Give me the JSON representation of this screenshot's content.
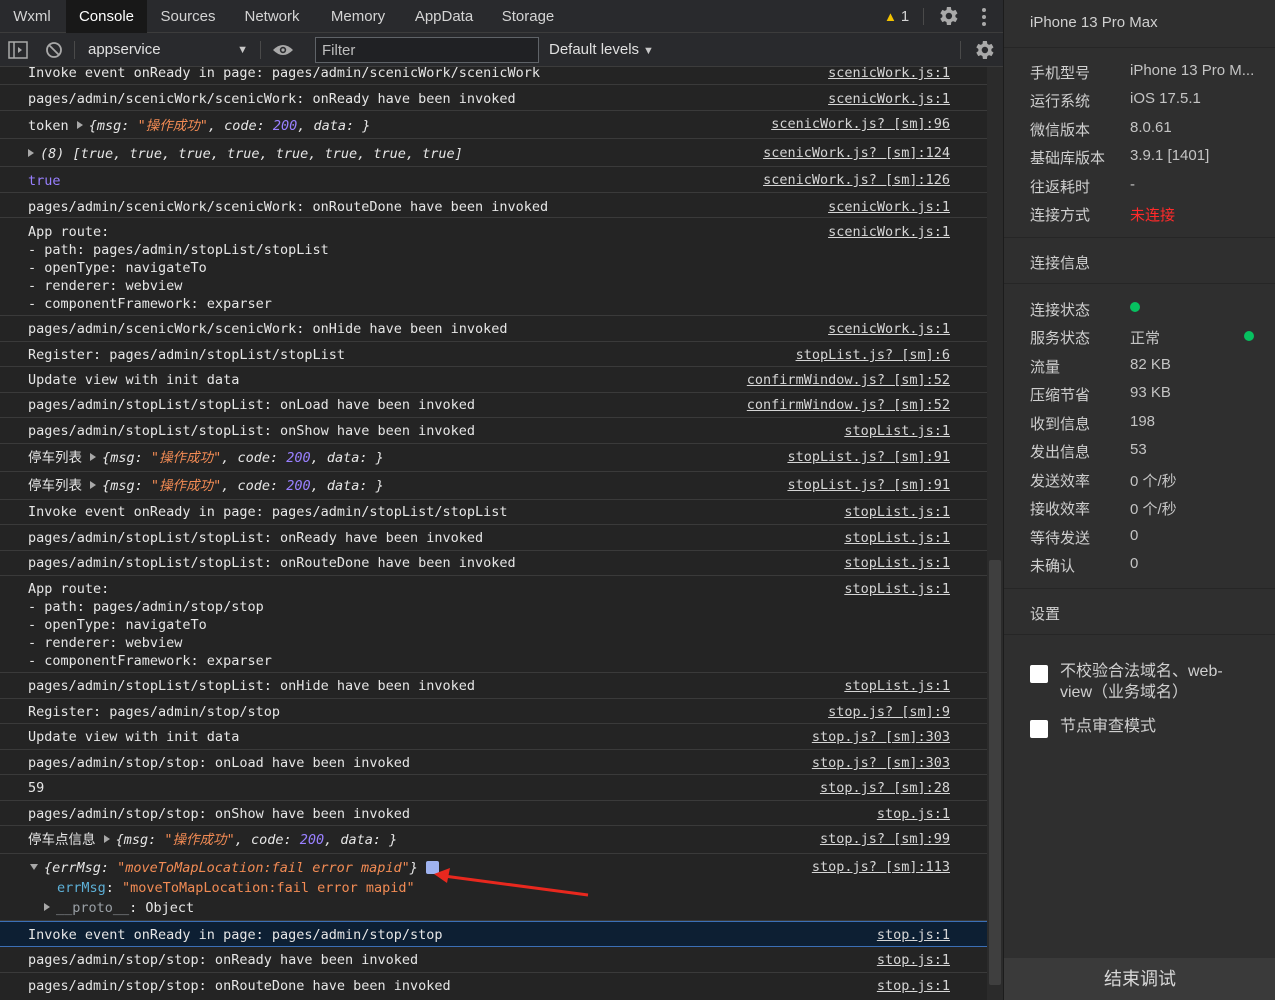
{
  "tabs": [
    "Wxml",
    "Console",
    "Sources",
    "Network",
    "Memory",
    "AppData",
    "Storage"
  ],
  "warning_count": "1",
  "toolbar": {
    "context": "appservice",
    "filter_placeholder": "Filter",
    "levels": "Default levels"
  },
  "logs": [
    {
      "msg": "Invoke event onReady in page: pages/admin/scenicWork/scenicWork",
      "src": "scenicWork.js:1"
    },
    {
      "msg": "pages/admin/scenicWork/scenicWork: onReady have been invoked",
      "src": "scenicWork.js:1"
    },
    {
      "label": "token",
      "obj": {
        "msg": "操作成功",
        "code": "200",
        "data": ""
      },
      "src": "scenicWork.js? [sm]:96"
    },
    {
      "array_prefix": "(8)",
      "array": [
        "true",
        "true",
        "true",
        "true",
        "true",
        "true",
        "true",
        "true"
      ],
      "src": "scenicWork.js? [sm]:124"
    },
    {
      "bool": "true",
      "src": "scenicWork.js? [sm]:126"
    },
    {
      "msg": "pages/admin/scenicWork/scenicWork: onRouteDone have been invoked",
      "src": "scenicWork.js:1"
    },
    {
      "lines": [
        "App route:",
        "- path: pages/admin/stopList/stopList",
        "- openType: navigateTo",
        "- renderer: webview",
        "- componentFramework: exparser"
      ],
      "src": "scenicWork.js:1"
    },
    {
      "msg": "pages/admin/scenicWork/scenicWork: onHide have been invoked",
      "src": "scenicWork.js:1"
    },
    {
      "msg": "Register: pages/admin/stopList/stopList",
      "src": "stopList.js? [sm]:6"
    },
    {
      "msg": "Update view with init data",
      "src": "confirmWindow.js? [sm]:52"
    },
    {
      "msg": "pages/admin/stopList/stopList: onLoad have been invoked",
      "src": "confirmWindow.js? [sm]:52"
    },
    {
      "msg": "pages/admin/stopList/stopList: onShow have been invoked",
      "src": "stopList.js:1"
    },
    {
      "label": "停车列表",
      "obj": {
        "msg": "操作成功",
        "code": "200",
        "data": ""
      },
      "src": "stopList.js? [sm]:91"
    },
    {
      "label": "停车列表",
      "obj": {
        "msg": "操作成功",
        "code": "200",
        "data": ""
      },
      "src": "stopList.js? [sm]:91"
    },
    {
      "msg": "Invoke event onReady in page: pages/admin/stopList/stopList",
      "src": "stopList.js:1"
    },
    {
      "msg": "pages/admin/stopList/stopList: onReady have been invoked",
      "src": "stopList.js:1"
    },
    {
      "msg": "pages/admin/stopList/stopList: onRouteDone have been invoked",
      "src": "stopList.js:1"
    },
    {
      "lines": [
        "App route:",
        "- path: pages/admin/stop/stop",
        "- openType: navigateTo",
        "- renderer: webview",
        "- componentFramework: exparser"
      ],
      "src": "stopList.js:1"
    },
    {
      "msg": "pages/admin/stopList/stopList: onHide have been invoked",
      "src": "stopList.js:1"
    },
    {
      "msg": "Register: pages/admin/stop/stop",
      "src": "stop.js? [sm]:9"
    },
    {
      "msg": "Update view with init data",
      "src": "stop.js? [sm]:303"
    },
    {
      "msg": "pages/admin/stop/stop: onLoad have been invoked",
      "src": "stop.js? [sm]:303"
    },
    {
      "msg": "59",
      "src": "stop.js? [sm]:28"
    },
    {
      "msg": "pages/admin/stop/stop: onShow have been invoked",
      "src": "stop.js:1"
    },
    {
      "label": "停车点信息",
      "obj": {
        "msg": "操作成功",
        "code": "200",
        "data": ""
      },
      "src": "stop.js? [sm]:99"
    },
    {
      "error_obj": {
        "errMsg": "moveToMapLocation:fail error mapid"
      },
      "src": "stop.js? [sm]:113"
    },
    {
      "msg": "Invoke event onReady in page: pages/admin/stop/stop",
      "src": "stop.js:1",
      "selected": true
    },
    {
      "msg": "pages/admin/stop/stop: onReady have been invoked",
      "src": "stop.js:1"
    },
    {
      "msg": "pages/admin/stop/stop: onRouteDone have been invoked",
      "src": "stop.js:1"
    }
  ],
  "expanded": {
    "key": "errMsg",
    "value": "\"moveToMapLocation:fail error mapid\"",
    "proto_key": "__proto__",
    "proto_value": "Object"
  },
  "panel": {
    "device": "iPhone 13 Pro Max",
    "info": [
      {
        "label": "手机型号",
        "value": "iPhone 13 Pro M..."
      },
      {
        "label": "运行系统",
        "value": "iOS 17.5.1"
      },
      {
        "label": "微信版本",
        "value": "8.0.61"
      },
      {
        "label": "基础库版本",
        "value": "3.9.1 [1401]"
      },
      {
        "label": "往返耗时",
        "value": "-"
      },
      {
        "label": "连接方式",
        "value": "未连接"
      }
    ],
    "conn_header": "连接信息",
    "conn": [
      {
        "label": "连接状态",
        "value": ""
      },
      {
        "label": "服务状态",
        "value": "正常"
      },
      {
        "label": "流量",
        "value": "82 KB"
      },
      {
        "label": "压缩节省",
        "value": "93 KB"
      },
      {
        "label": "收到信息",
        "value": "198"
      },
      {
        "label": "发出信息",
        "value": "53"
      },
      {
        "label": "发送效率",
        "value": "0 个/秒"
      },
      {
        "label": "接收效率",
        "value": "0 个/秒"
      },
      {
        "label": "等待发送",
        "value": "0"
      },
      {
        "label": "未确认",
        "value": "0"
      }
    ],
    "settings_header": "设置",
    "settings": [
      {
        "label": "不校验合法域名、web-view（业务域名）",
        "checked": false
      },
      {
        "label": "节点审查模式",
        "checked": false
      }
    ],
    "end_button": "结束调试",
    "status_color": "#07c160",
    "alert_color": "#ff2a2a"
  }
}
